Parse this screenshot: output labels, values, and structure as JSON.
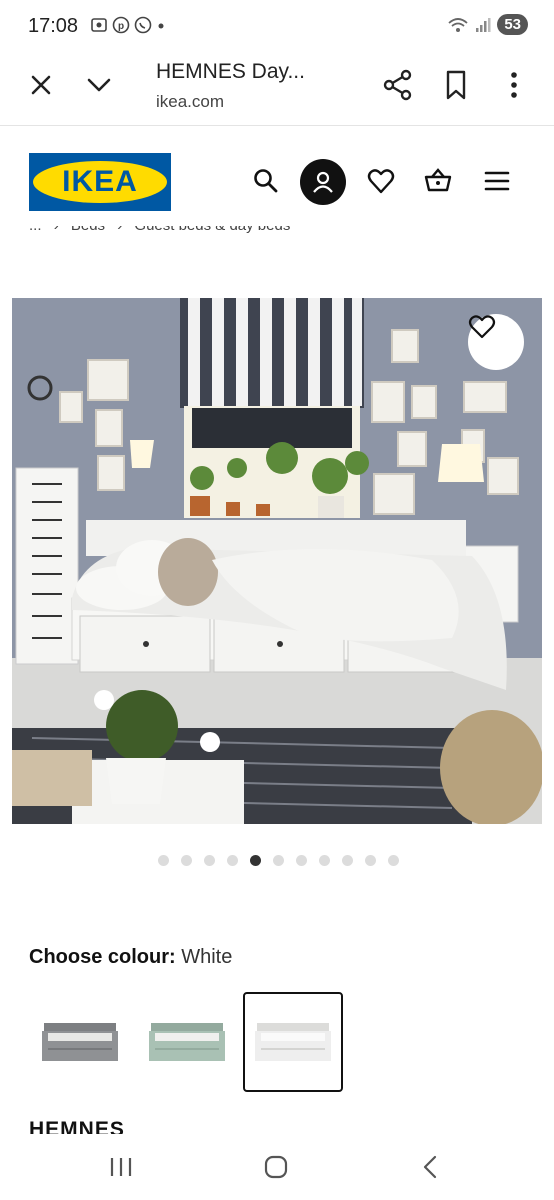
{
  "status_bar": {
    "time": "17:08",
    "battery": "53",
    "left_icons": [
      "screenshot-icon",
      "pinterest-icon",
      "whatsapp-icon",
      "dot-icon"
    ],
    "right_icons": [
      "wifi-icon",
      "signal-icon"
    ]
  },
  "browser": {
    "title": "HEMNES Day...",
    "url": "ikea.com"
  },
  "header": {
    "logo_text": "IKEA",
    "brand_blue": "#0058a3",
    "brand_yellow": "#ffdb00"
  },
  "breadcrumb": {
    "items": [
      "...",
      "Beds",
      "Guest beds & day beds"
    ],
    "separator": "›"
  },
  "gallery": {
    "total": 11,
    "active_index": 4
  },
  "colour": {
    "label": "Choose colour:",
    "value": "White",
    "swatches": [
      {
        "name": "grey",
        "color": "#8f9194"
      },
      {
        "name": "green",
        "color": "#a9c1b4"
      },
      {
        "name": "white",
        "color": "#eeeeee",
        "selected": true
      }
    ]
  },
  "product": {
    "name": "HEMNES"
  }
}
